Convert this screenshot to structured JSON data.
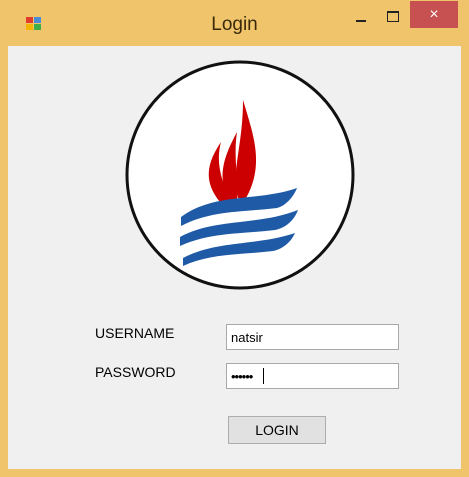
{
  "window": {
    "title": "Login",
    "icon": "app-window-icon",
    "controls": {
      "minimize": "minimize-icon",
      "maximize": "maximize-icon",
      "close": "×"
    }
  },
  "logo": {
    "icon": "flame-waves-emblem",
    "colors": {
      "flame": "#cc0000",
      "waves": "#1f5aa6",
      "ring": "#111111"
    }
  },
  "form": {
    "username_label": "USERNAME",
    "password_label": "PASSWORD",
    "username_value": "natsir",
    "password_value": "••••••",
    "login_label": "LOGIN"
  },
  "colors": {
    "titlebar": "#f0c46a",
    "close": "#c75050",
    "client": "#f0f0f0"
  }
}
